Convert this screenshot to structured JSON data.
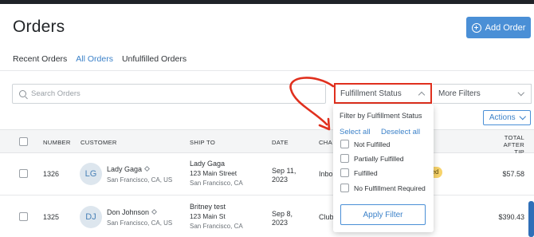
{
  "page": {
    "title": "Orders"
  },
  "header": {
    "add_order_label": "Add Order"
  },
  "tabs": [
    {
      "label": "Recent Orders",
      "active": false
    },
    {
      "label": "All Orders",
      "active": true
    },
    {
      "label": "Unfulfilled Orders",
      "active": false
    }
  ],
  "filters": {
    "search_placeholder": "Search Orders",
    "fulfillment_status_label": "Fulfillment Status",
    "more_filters_label": "More Filters",
    "actions_label": "Actions"
  },
  "table": {
    "columns": {
      "number": "NUMBER",
      "customer": "CUSTOMER",
      "ship_to": "SHIP TO",
      "date": "DATE",
      "channel": "CHA",
      "total_line1": "TOTAL AFTER",
      "total_line2": "TIP"
    },
    "rows": [
      {
        "number": "1326",
        "initials": "LG",
        "customer_name": "Lady Gaga",
        "customer_location": "San Francisco, CA, US",
        "ship_name": "Lady Gaga",
        "ship_street": "123 Main Street",
        "ship_city": "San Francisco, CA",
        "date_line1": "Sep 11,",
        "date_line2": "2023",
        "channel": "Inbo",
        "status_badge": "lled",
        "total": "$57.58"
      },
      {
        "number": "1325",
        "initials": "DJ",
        "customer_name": "Don Johnson",
        "customer_location": "San Francisco, CA, US",
        "ship_name": "Britney test",
        "ship_street": "123 Main St",
        "ship_city": "San Francisco, CA",
        "date_line1": "Sep 8,",
        "date_line2": "2023",
        "channel": "Club",
        "total": "$390.43"
      }
    ]
  },
  "fulfillment_popup": {
    "title": "Filter by Fulfillment Status",
    "select_all": "Select all",
    "deselect_all": "Deselect all",
    "options": [
      "Not Fulfilled",
      "Partially Fulfilled",
      "Fulfilled",
      "No Fulfillment Required"
    ],
    "apply_label": "Apply Filter"
  },
  "colors": {
    "accent": "#4a8fd6",
    "highlight_annotation": "#e0301e",
    "badge": "#f7d36a"
  }
}
